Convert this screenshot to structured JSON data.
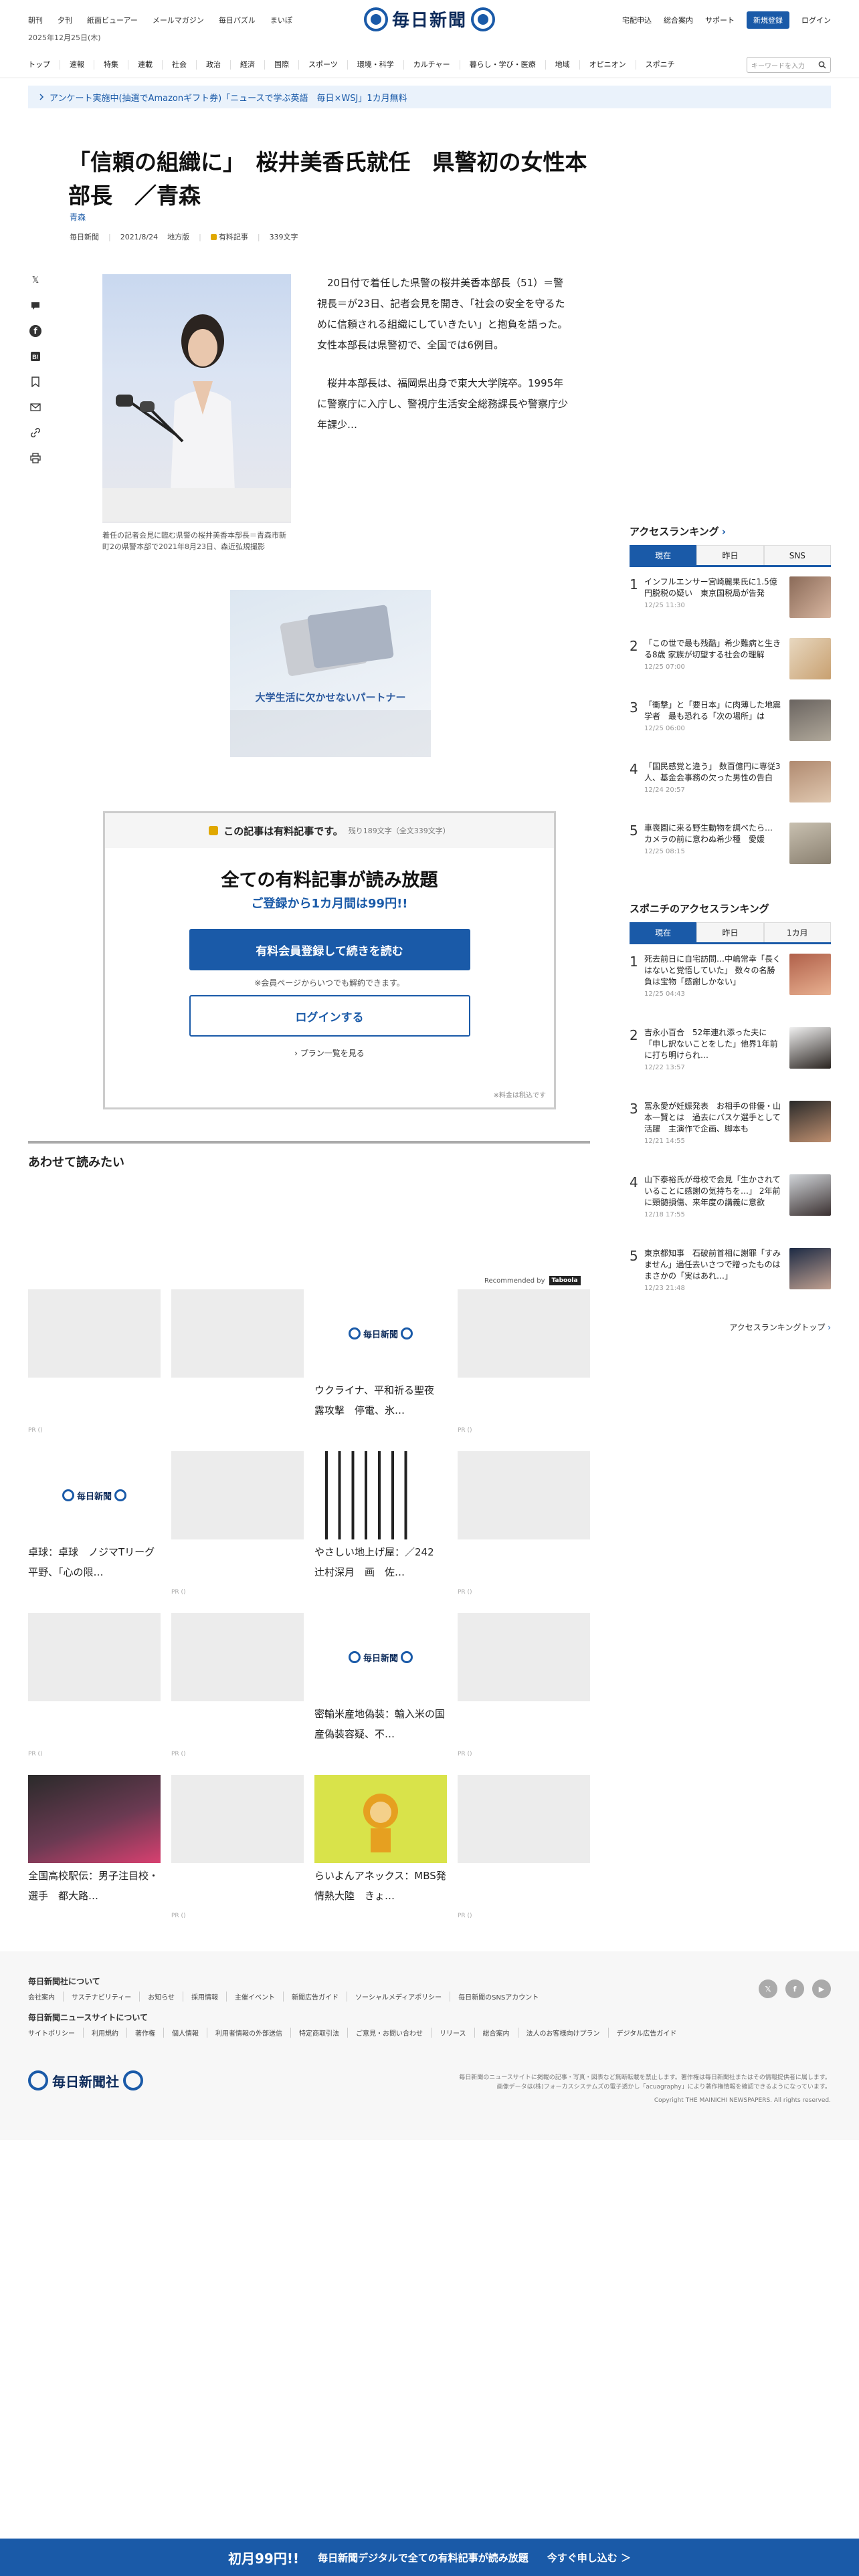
{
  "header": {
    "top_nav": [
      "朝刊",
      "夕刊",
      "紙面ビューアー",
      "メールマガジン",
      "毎日パズル",
      "まいぽ"
    ],
    "brand": "毎日新聞",
    "right_nav": [
      "宅配申込",
      "総合案内",
      "サポート"
    ],
    "register": "新規登録",
    "login": "ログイン",
    "date": "2025年12月25日(木)"
  },
  "categories": [
    "トップ",
    "速報",
    "特集",
    "連載",
    "社会",
    "政治",
    "経済",
    "国際",
    "スポーツ",
    "環境・科学",
    "カルチャー",
    "暮らし・学び・医療",
    "地域",
    "オピニオン",
    "スポニチ"
  ],
  "search": {
    "placeholder": "キーワードを入力"
  },
  "notice": "アンケート実施中(抽選でAmazonギフト券)「ニュースで学ぶ英語　毎日×WSJ」1カ月無料",
  "article": {
    "title": "「信頼の組織に」　桜井美香氏就任　県警初の女性本部長　／青森",
    "tag": "青森",
    "source": "毎日新聞",
    "date": "2021/8/24",
    "section": "地方版",
    "paid": "有料記事",
    "chars": "339文字",
    "caption": "着任の記者会見に臨む県警の桜井美香本部長＝青森市新町2の県警本部で2021年8月23日、森近弘規撮影",
    "lead1": "20日付で着任した県警の桜井美香本部長（51）＝警視長＝が23日、記者会見を開き、「社会の安全を守るために信頼される組織にしていきたい」と抱負を語った。女性本部長は県警初で、全国では6例目。",
    "lead2": "桜井本部長は、福岡県出身で東大大学院卒。1995年に警察庁に入庁し、警視庁生活安全総務課長や警察庁少年課少…"
  },
  "ad": {
    "caption": "大学生活に欠かせないパートナー"
  },
  "paywall": {
    "header": "この記事は有料記事です。",
    "remain": "残り189文字（全文339文字）",
    "title": "全ての有料記事が読み放題",
    "sub": "ご登録から1カ月間は99円!!",
    "cta": "有料会員登録して続きを読む",
    "note": "※会員ページからいつでも解約できます。",
    "login": "ログインする",
    "plans": "プラン一覧を見る",
    "tax": "※料金は税込です"
  },
  "related": {
    "title": "あわせて読みたい",
    "recommended": "Recommended by",
    "recommended_brand": "Taboola",
    "cards": [
      {
        "title": "",
        "pr": "PR ()"
      },
      {
        "title": "",
        "pr": ""
      },
      {
        "title": "ウクライナ、平和祈る聖夜　露攻撃　停電、氷…",
        "pr": ""
      },
      {
        "title": "",
        "pr": "PR ()"
      },
      {
        "title": "卓球：卓球　ノジマTリーグ　平野、「心の限…",
        "pr": ""
      },
      {
        "title": "",
        "pr": "PR ()"
      },
      {
        "title": "やさしい地上げ屋：／242　辻村深月　画　佐…",
        "pr": ""
      },
      {
        "title": "",
        "pr": "PR ()"
      },
      {
        "title": "",
        "pr": "PR ()"
      },
      {
        "title": "",
        "pr": "PR ()"
      },
      {
        "title": "密輸米産地偽装：輸入米の国産偽装容疑、不…",
        "pr": ""
      },
      {
        "title": "",
        "pr": "PR ()"
      },
      {
        "title": "全国高校駅伝：男子注目校・選手　都大路…",
        "pr": ""
      },
      {
        "title": "",
        "pr": "PR ()"
      },
      {
        "title": "らいよんアネックス：MBS発　情熱大陸　きょ…",
        "pr": ""
      },
      {
        "title": "",
        "pr": "PR ()"
      }
    ]
  },
  "ranking": {
    "title": "アクセスランキング",
    "tabs": [
      "現在",
      "昨日",
      "SNS"
    ],
    "items": [
      {
        "num": "1",
        "title": "インフルエンサー宮崎麗果氏に1.5億円脱税の疑い　東京国税局が告発",
        "date": "12/25 11:30"
      },
      {
        "num": "2",
        "title": "「この世で最も残酷」希少難病と生きる8歳 家族が切望する社会の理解",
        "date": "12/25 07:00"
      },
      {
        "num": "3",
        "title": "「衝撃」と「要日本」に肉薄した地震学者　最も恐れる「次の場所」は",
        "date": "12/25 06:00"
      },
      {
        "num": "4",
        "title": "「国民感覚と違う」 数百億円に専従3人、基金会事務の欠った男性の告白",
        "date": "12/24 20:57"
      },
      {
        "num": "5",
        "title": "車喪園に来る野生動物を調べたら…　カメラの前に意わぬ希少種　愛媛",
        "date": "12/25 08:15"
      }
    ]
  },
  "sponichi": {
    "title": "スポニチのアクセスランキング",
    "tabs": [
      "現在",
      "昨日",
      "1カ月"
    ],
    "items": [
      {
        "num": "1",
        "title": "死去前日に自宅訪問…中嶋常幸「長くはないと覚悟していた」 数々の名勝負は宝物「感謝しかない」",
        "date": "12/25 04:43"
      },
      {
        "num": "2",
        "title": "吉永小百合　52年連れ添った夫に「申し訳ないことをした」他界1年前に打ち明けられ…",
        "date": "12/22 13:57"
      },
      {
        "num": "3",
        "title": "冨永愛が妊娠発表　お相手の俳優・山本一賢とは　過去にバスケ選手として活躍　主演作で企画、脚本も",
        "date": "12/21 14:55"
      },
      {
        "num": "4",
        "title": "山下泰裕氏が母校で会見「生かされていることに感謝の気持ちを…」 2年前に頸髄損傷、来年度の講義に意欲",
        "date": "12/18 17:55"
      },
      {
        "num": "5",
        "title": "東京都知事　石破前首相に謝罪「すみません」過任去いさつで贈ったものはまさかの「実はあれ…」",
        "date": "12/23 21:48"
      }
    ],
    "more": "アクセスランキングトップ"
  },
  "footer": {
    "about_title": "毎日新聞社について",
    "about_links": [
      "会社案内",
      "サステナビリティー",
      "お知らせ",
      "採用情報",
      "主催イベント",
      "新聞広告ガイド",
      "ソーシャルメディアポリシー",
      "毎日新聞のSNSアカウント"
    ],
    "site_title": "毎日新聞ニュースサイトについて",
    "site_links": [
      "サイトポリシー",
      "利用規約",
      "著作権",
      "個人情報",
      "利用者情報の外部送信",
      "特定商取引法",
      "ご意見・お問い合わせ",
      "リリース",
      "総合案内",
      "法人のお客様向けプラン",
      "デジタル広告ガイド"
    ],
    "brand": "毎日新聞社",
    "copy1": "毎日新聞のニュースサイトに掲載の記事・写真・図表など無断転載を禁止します。著作権は毎日新聞社またはその情報提供者に属します。",
    "copy2": "画像データは(株)フォーカスシステムズの電子透かし「acuagraphy」により著作権情報を確認できるようになっています。",
    "copyright": "Copyright THE MAINICHI NEWSPAPERS. All rights reserved."
  },
  "banner": {
    "price": "初月99円!!",
    "text": "毎日新聞デジタルで全ての有料記事が読み放題",
    "cta": "今すぐ申し込む ＞"
  }
}
